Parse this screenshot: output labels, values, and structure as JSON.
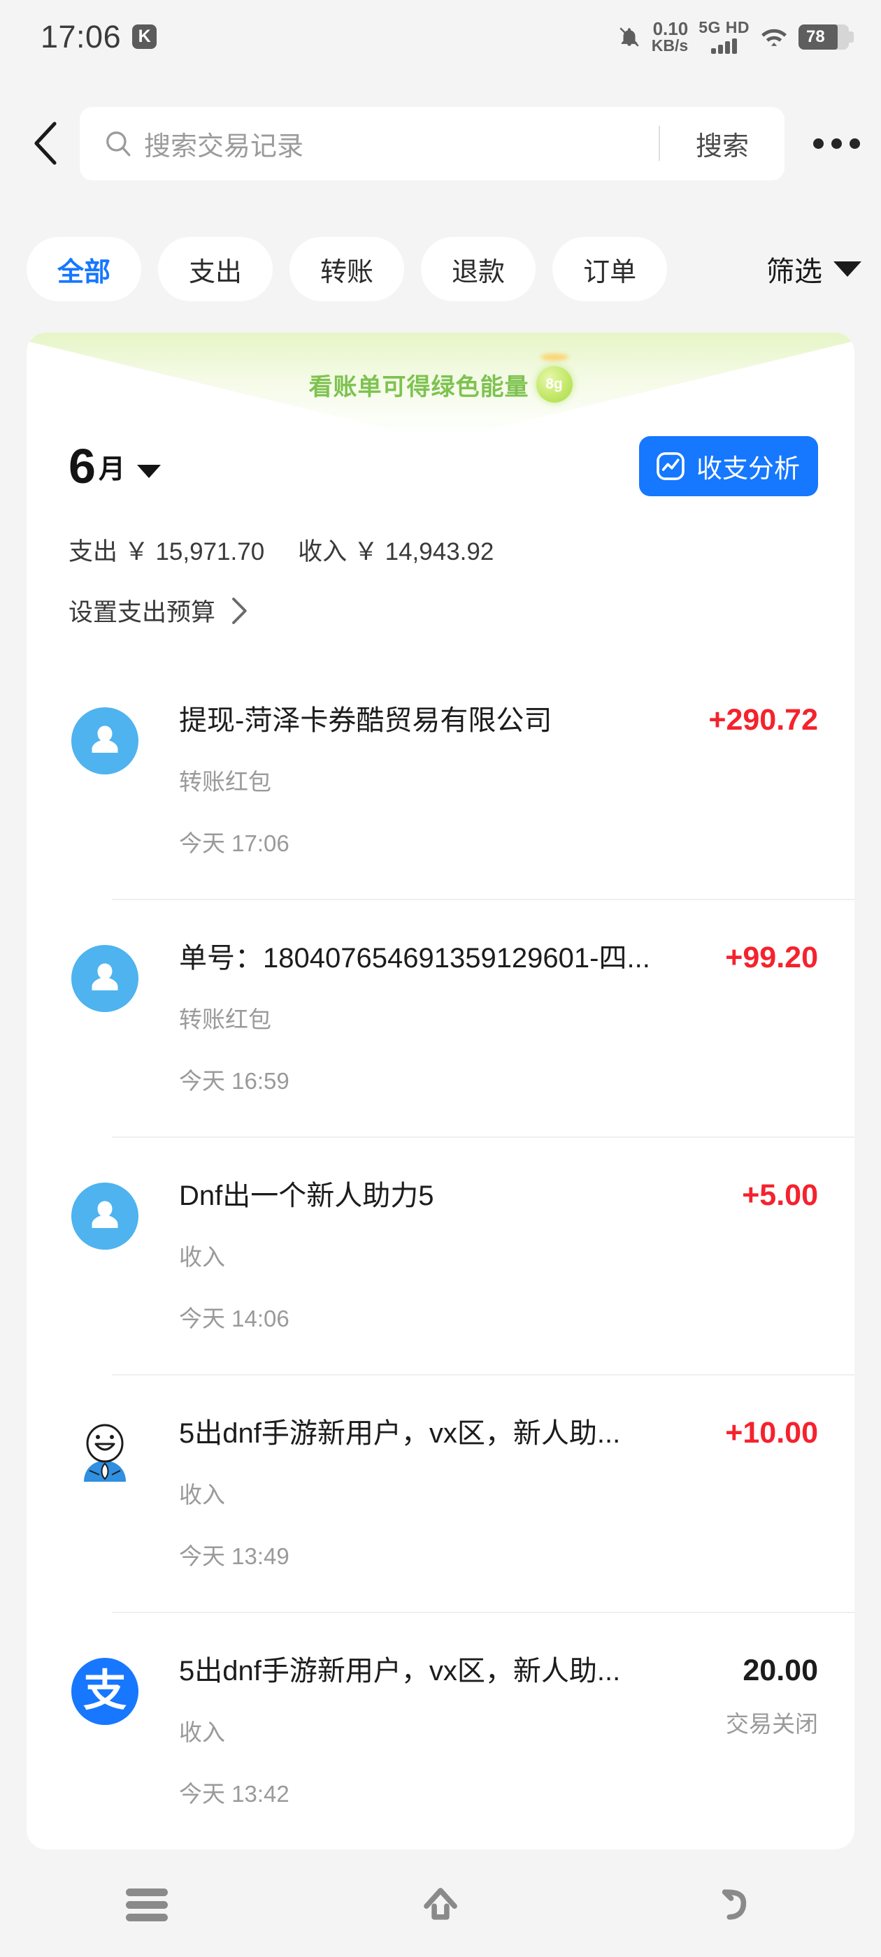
{
  "status_bar": {
    "time": "17:06",
    "app_badge": "K",
    "net_speed_value": "0.10",
    "net_speed_unit": "KB/s",
    "network_label": "5G HD",
    "battery_percent": "78",
    "icons": [
      "bell-muted-icon",
      "signal-bars-icon",
      "wifi-icon",
      "battery-icon"
    ]
  },
  "header": {
    "back_icon": "chevron-left-icon",
    "search_placeholder": "搜索交易记录",
    "search_button": "搜索",
    "more_icon": "more-horizontal-icon"
  },
  "filters": {
    "chips": [
      {
        "label": "全部",
        "active": true
      },
      {
        "label": "支出",
        "active": false
      },
      {
        "label": "转账",
        "active": false
      },
      {
        "label": "退款",
        "active": false
      },
      {
        "label": "订单",
        "active": false
      }
    ],
    "filter_button": "筛选"
  },
  "card": {
    "energy_banner": {
      "text": "看账单可得绿色能量",
      "ball_value": "8g"
    },
    "month": {
      "number": "6",
      "unit": "月"
    },
    "analysis_button": "收支分析",
    "totals": {
      "expense": "支出 ￥ 15,971.70",
      "income": "收入 ￥ 14,943.92"
    },
    "budget_link": "设置支出预算"
  },
  "transactions": [
    {
      "avatar": "default-person-avatar",
      "title": "提现-菏泽卡券酷贸易有限公司",
      "subtitle": "转账红包",
      "time": "今天 17:06",
      "amount": "+290.72",
      "status": "",
      "closed": false
    },
    {
      "avatar": "default-person-avatar",
      "title": "单号：180407654691359129601-四...",
      "subtitle": "转账红包",
      "time": "今天 16:59",
      "amount": "+99.20",
      "status": "",
      "closed": false
    },
    {
      "avatar": "default-person-avatar",
      "title": "Dnf出一个新人助力5",
      "subtitle": "收入",
      "time": "今天 14:06",
      "amount": "+5.00",
      "status": "",
      "closed": false
    },
    {
      "avatar": "cartoon-person-avatar",
      "title": "5出dnf手游新用户，vx区，新人助...",
      "subtitle": "收入",
      "time": "今天 13:49",
      "amount": "+10.00",
      "status": "",
      "closed": false
    },
    {
      "avatar": "alipay-logo-avatar",
      "title": "5出dnf手游新用户，vx区，新人助...",
      "subtitle": "收入",
      "time": "今天 13:42",
      "amount": "20.00",
      "status": "交易关闭",
      "closed": true
    }
  ],
  "nav_bar": {
    "recents": "recents-icon",
    "home": "home-icon",
    "back": "back-icon"
  },
  "colors": {
    "accent_blue": "#1677ff",
    "amount_red": "#f5222d",
    "energy_green": "#7ec250",
    "page_bg": "#f4f4f4",
    "avatar_blue": "#4eb3ee"
  }
}
